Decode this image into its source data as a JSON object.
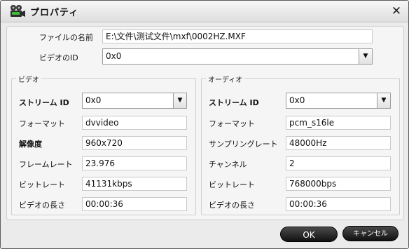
{
  "window": {
    "title": "プロパティ"
  },
  "file": {
    "label": "ファイルの名前",
    "value": "E:\\文件\\测试文件\\mxf\\0002HZ.MXF"
  },
  "video_id": {
    "label": "ビデオのID",
    "value": "0x0"
  },
  "video": {
    "group_title": "ビデオ",
    "stream_id_label": "ストリーム ID",
    "stream_id": "0x0",
    "format_label": "フォーマット",
    "format": "dvvideo",
    "resolution_label": "解像度",
    "resolution": "960x720",
    "framerate_label": "フレームレート",
    "framerate": "23.976",
    "bitrate_label": "ビットレート",
    "bitrate": "41131kbps",
    "duration_label": "ビデオの長さ",
    "duration": "00:00:36"
  },
  "audio": {
    "group_title": "オーディオ",
    "stream_id_label": "ストリーム ID",
    "stream_id": "0x0",
    "format_label": "フォーマット",
    "format": "pcm_s16le",
    "samplerate_label": "サンプリングレート",
    "samplerate": "48000Hz",
    "channels_label": "チャンネル",
    "channels": "2",
    "bitrate_label": "ビットレート",
    "bitrate": "768000bps",
    "duration_label": "ビデオの長さ",
    "duration": "00:00:36"
  },
  "buttons": {
    "ok": "OK",
    "cancel": "キャンセル"
  },
  "icons": {
    "app": "film-projector-icon",
    "close": "close-icon",
    "dropdown": "chevron-down-icon"
  }
}
